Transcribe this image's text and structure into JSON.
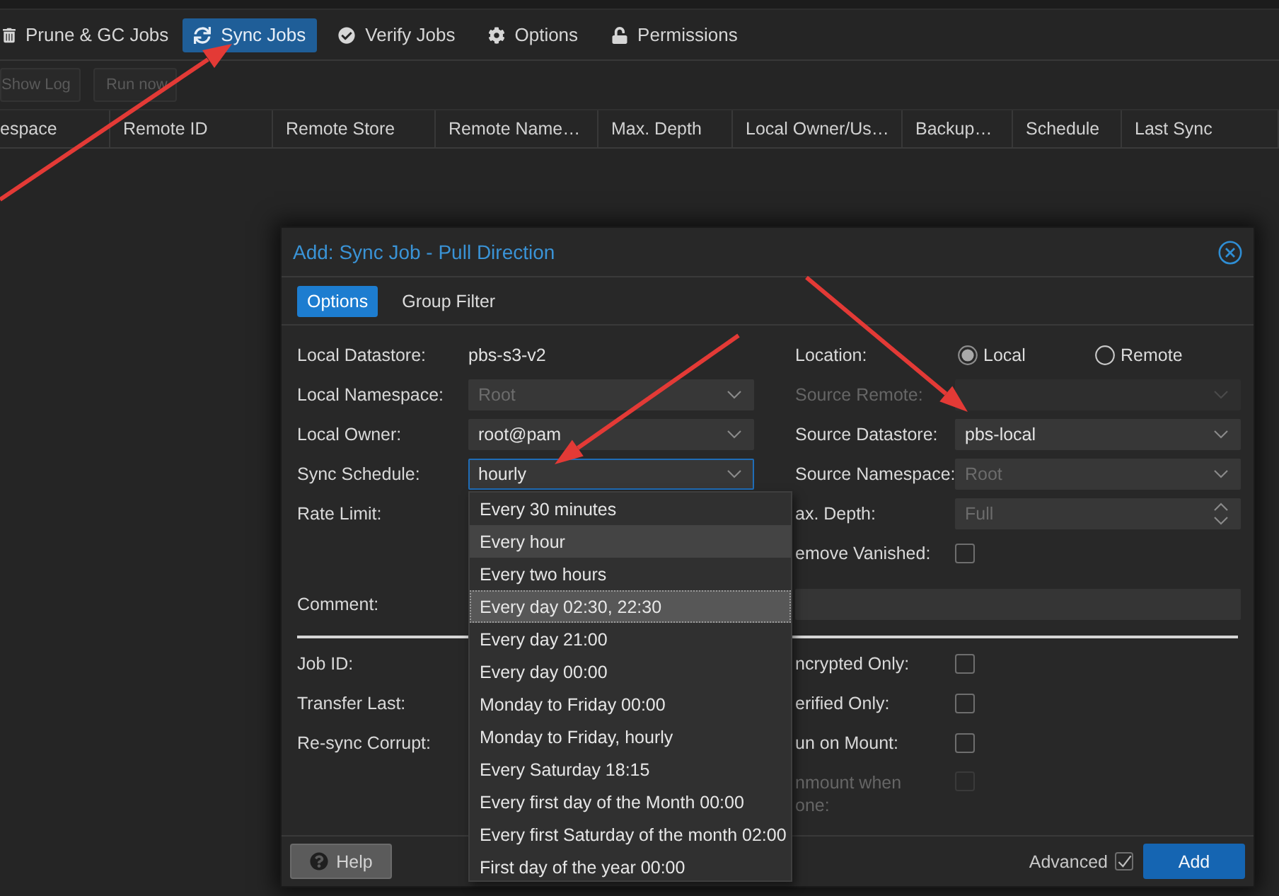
{
  "page_tabs": [
    {
      "label": "Prune & GC Jobs",
      "selected": false
    },
    {
      "label": "Sync Jobs",
      "selected": true
    },
    {
      "label": "Verify Jobs",
      "selected": false
    },
    {
      "label": "Options",
      "selected": false
    },
    {
      "label": "Permissions",
      "selected": false
    }
  ],
  "toolbar": [
    {
      "label": "Show Log",
      "disabled": true
    },
    {
      "label": "Run now",
      "disabled": true
    }
  ],
  "table": {
    "columns": [
      "espace",
      "Remote ID",
      "Remote Store",
      "Remote Name…",
      "Max. Depth",
      "Local Owner/Us…",
      "Backup…",
      "Schedule",
      "Last Sync"
    ]
  },
  "dialog": {
    "title": "Add: Sync Job - Pull Direction",
    "tabs": [
      {
        "label": "Options",
        "selected": true
      },
      {
        "label": "Group Filter",
        "selected": false
      }
    ],
    "left_fields": [
      {
        "kind": "text",
        "label": "Local Datastore:",
        "value": "pbs-s3-v2"
      },
      {
        "kind": "combo",
        "label": "Local Namespace:",
        "placeholder": "Root",
        "disabled": false,
        "focused": false
      },
      {
        "kind": "combo",
        "label": "Local Owner:",
        "value": "root@pam",
        "disabled": false,
        "focused": false
      },
      {
        "kind": "combo",
        "label": "Sync Schedule:",
        "value": "hourly",
        "disabled": false,
        "focused": true
      },
      {
        "kind": "label",
        "label": "Rate Limit:"
      }
    ],
    "right_fields": [
      {
        "kind": "radio",
        "label": "Location:",
        "options": [
          {
            "label": "Local",
            "selected": true
          },
          {
            "label": "Remote",
            "selected": false
          }
        ]
      },
      {
        "kind": "combo",
        "label": "Source Remote:",
        "disabled": true,
        "focused": false
      },
      {
        "kind": "combo",
        "label": "Source Datastore:",
        "value": "pbs-local",
        "disabled": false,
        "focused": false
      },
      {
        "kind": "combo",
        "label": "Source Namespace:",
        "placeholder": "Root",
        "disabled": false,
        "focused": false
      },
      {
        "kind": "spinner",
        "label": "ax. Depth:",
        "placeholder": "Full"
      },
      {
        "kind": "checkbox",
        "label": "emove Vanished:",
        "checked": false,
        "disabled": false
      }
    ],
    "comment": {
      "label": "Comment:"
    },
    "advanced_left": [
      {
        "label": "Job ID:"
      },
      {
        "label": "Transfer Last:"
      },
      {
        "label": "Re-sync Corrupt:"
      }
    ],
    "advanced_right": [
      {
        "kind": "checkbox",
        "label": "ncrypted Only:",
        "checked": false,
        "disabled": false
      },
      {
        "kind": "checkbox",
        "label": "erified Only:",
        "checked": false,
        "disabled": false
      },
      {
        "kind": "checkbox",
        "label": "un on Mount:",
        "checked": false,
        "disabled": false
      },
      {
        "kind": "checkbox",
        "label": "nmount when one:",
        "checked": false,
        "disabled": true
      }
    ],
    "schedule_menu": [
      {
        "label": "Every 30 minutes",
        "selected": false,
        "hovered": false
      },
      {
        "label": "Every hour",
        "selected": true,
        "hovered": false
      },
      {
        "label": "Every two hours",
        "selected": false,
        "hovered": false
      },
      {
        "label": "Every day 02:30, 22:30",
        "selected": false,
        "hovered": true
      },
      {
        "label": "Every day 21:00",
        "selected": false,
        "hovered": false
      },
      {
        "label": "Every day 00:00",
        "selected": false,
        "hovered": false
      },
      {
        "label": "Monday to Friday 00:00",
        "selected": false,
        "hovered": false
      },
      {
        "label": "Monday to Friday, hourly",
        "selected": false,
        "hovered": false
      },
      {
        "label": "Every Saturday 18:15",
        "selected": false,
        "hovered": false
      },
      {
        "label": "Every first day of the Month 00:00",
        "selected": false,
        "hovered": false
      },
      {
        "label": "Every first Saturday of the month 02:00",
        "selected": false,
        "hovered": false
      },
      {
        "label": "First day of the year 00:00",
        "selected": false,
        "hovered": false
      }
    ],
    "footer": {
      "help": "Help",
      "advanced": {
        "label": "Advanced",
        "checked": true
      },
      "submit": "Add"
    }
  }
}
